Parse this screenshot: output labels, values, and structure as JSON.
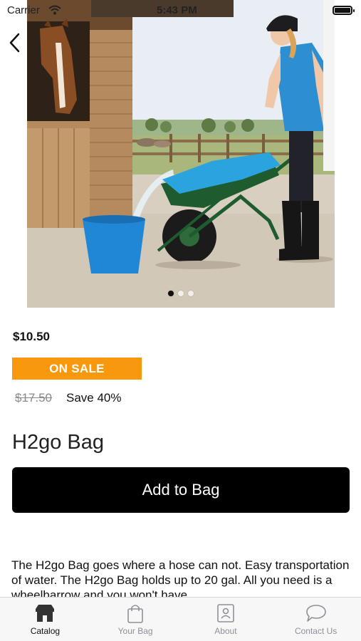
{
  "status_bar": {
    "carrier": "Carrier",
    "time": "5:43 PM"
  },
  "product": {
    "image_dots": 3,
    "price": "$10.50",
    "sale_badge": "ON SALE",
    "original_price": "$17.50",
    "save_text": "Save 40%",
    "title": "H2go Bag",
    "add_button_label": "Add to Bag",
    "description": "The H2go Bag goes where a hose can not. Easy transportation of water. The H2go Bag holds up to 20 gal. All you need is a wheelbarrow and you won't have"
  },
  "tabs": [
    {
      "label": "Catalog",
      "icon": "storefront-icon",
      "active": true
    },
    {
      "label": "Your Bag",
      "icon": "shopping-bag-icon",
      "active": false
    },
    {
      "label": "About",
      "icon": "profile-card-icon",
      "active": false
    },
    {
      "label": "Contact Us",
      "icon": "chat-bubble-icon",
      "active": false
    }
  ],
  "colors": {
    "sale_badge": "#f7980d",
    "button": "#000000",
    "active_tab": "#111111",
    "inactive_tab": "#8f8f9a"
  }
}
